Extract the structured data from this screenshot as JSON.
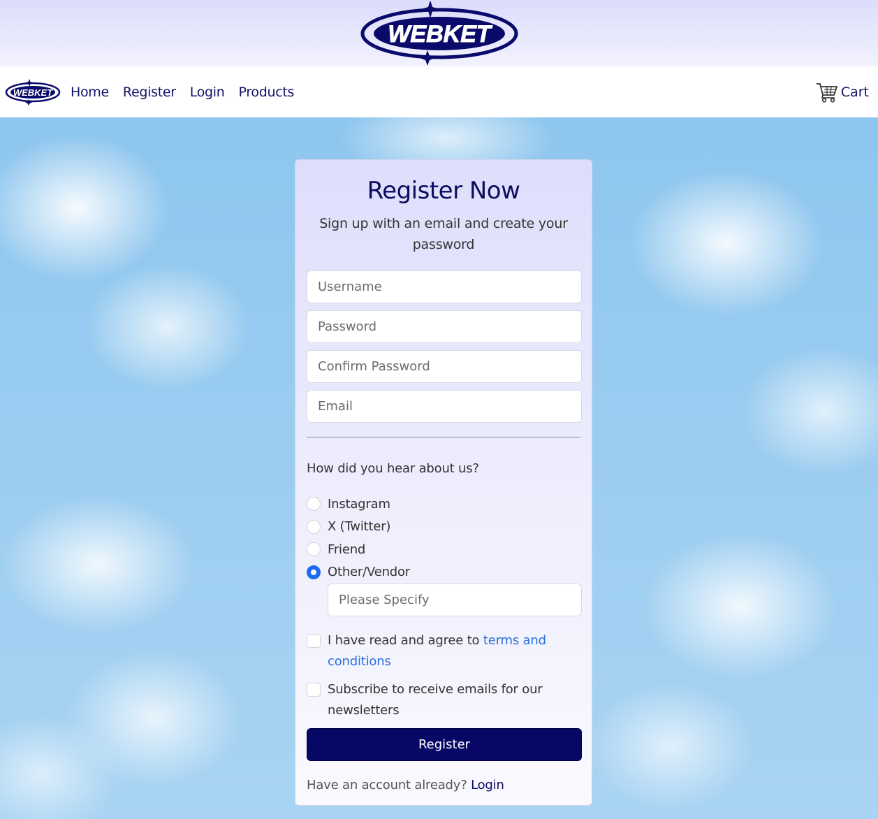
{
  "brand": {
    "name": "WEBKET",
    "color": "#070766"
  },
  "nav": {
    "items": [
      {
        "label": "Home"
      },
      {
        "label": "Register"
      },
      {
        "label": "Login"
      },
      {
        "label": "Products"
      }
    ],
    "cart_label": "Cart",
    "cart_icon": "cart-icon"
  },
  "form": {
    "title": "Register Now",
    "subtitle": "Sign up with an email and create your password",
    "username_placeholder": "Username",
    "password_placeholder": "Password",
    "confirm_placeholder": "Confirm Password",
    "email_placeholder": "Email",
    "question": "How did you hear about us?",
    "options": [
      {
        "label": "Instagram",
        "checked": false
      },
      {
        "label": "X (Twitter)",
        "checked": false
      },
      {
        "label": "Friend",
        "checked": false
      },
      {
        "label": "Other/Vendor",
        "checked": true
      }
    ],
    "specify_placeholder": "Please Specify",
    "terms_prefix": "I have read and agree to ",
    "terms_link": "terms and conditions",
    "newsletter_label": "Subscribe to receive emails for our newsletters",
    "submit_label": "Register",
    "footer_text": "Have an account already? ",
    "footer_link": "Login"
  },
  "colors": {
    "accent": "#1c6cf0",
    "navy": "#070766",
    "link": "#2a6fdb"
  }
}
